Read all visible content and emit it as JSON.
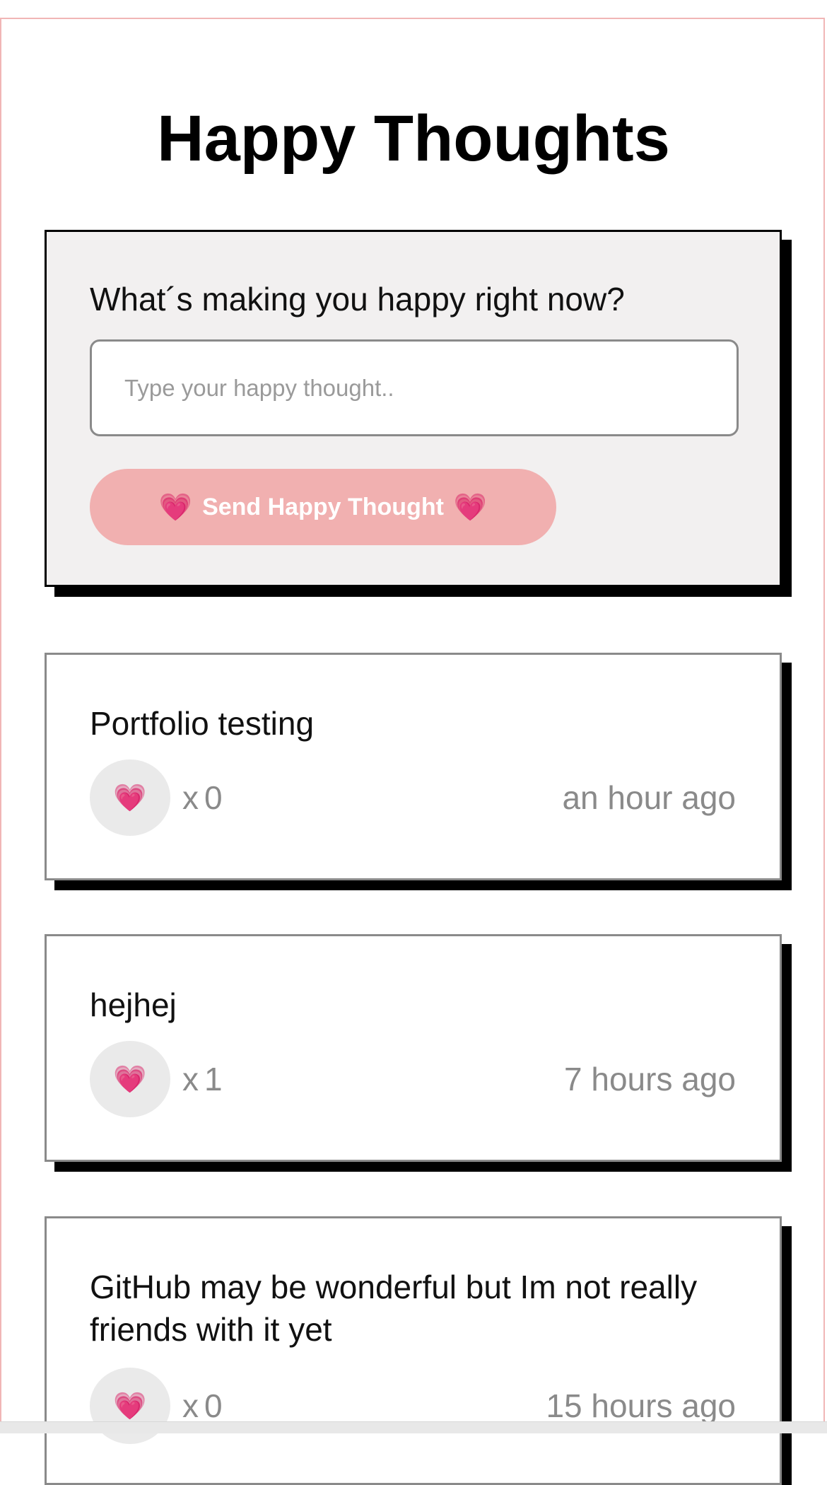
{
  "header": {
    "title": "Happy Thoughts"
  },
  "form": {
    "label": "What´s making you happy right now?",
    "input_placeholder": "Type your happy thought..",
    "input_value": "",
    "send_label": "Send Happy Thought",
    "send_icon": "heart-icon"
  },
  "thoughts": [
    {
      "text": "Portfolio testing",
      "like_icon": "heart-icon",
      "likes_prefix": "x",
      "likes": "0",
      "time": "an hour ago"
    },
    {
      "text": "hejhej",
      "like_icon": "heart-icon",
      "likes_prefix": "x",
      "likes": "1",
      "time": "7 hours ago"
    },
    {
      "text": "GitHub may be wonderful but Im not really friends with it yet",
      "like_icon": "heart-icon",
      "likes_prefix": "x",
      "likes": "0",
      "time": "15 hours ago"
    }
  ],
  "colors": {
    "accent": "#f1b0b0",
    "frame_border": "#f1b6b6",
    "card_background": "#f2f0f0",
    "shadow": "#000000",
    "muted_text": "#8a8a8a",
    "heart": "#e6428f"
  }
}
